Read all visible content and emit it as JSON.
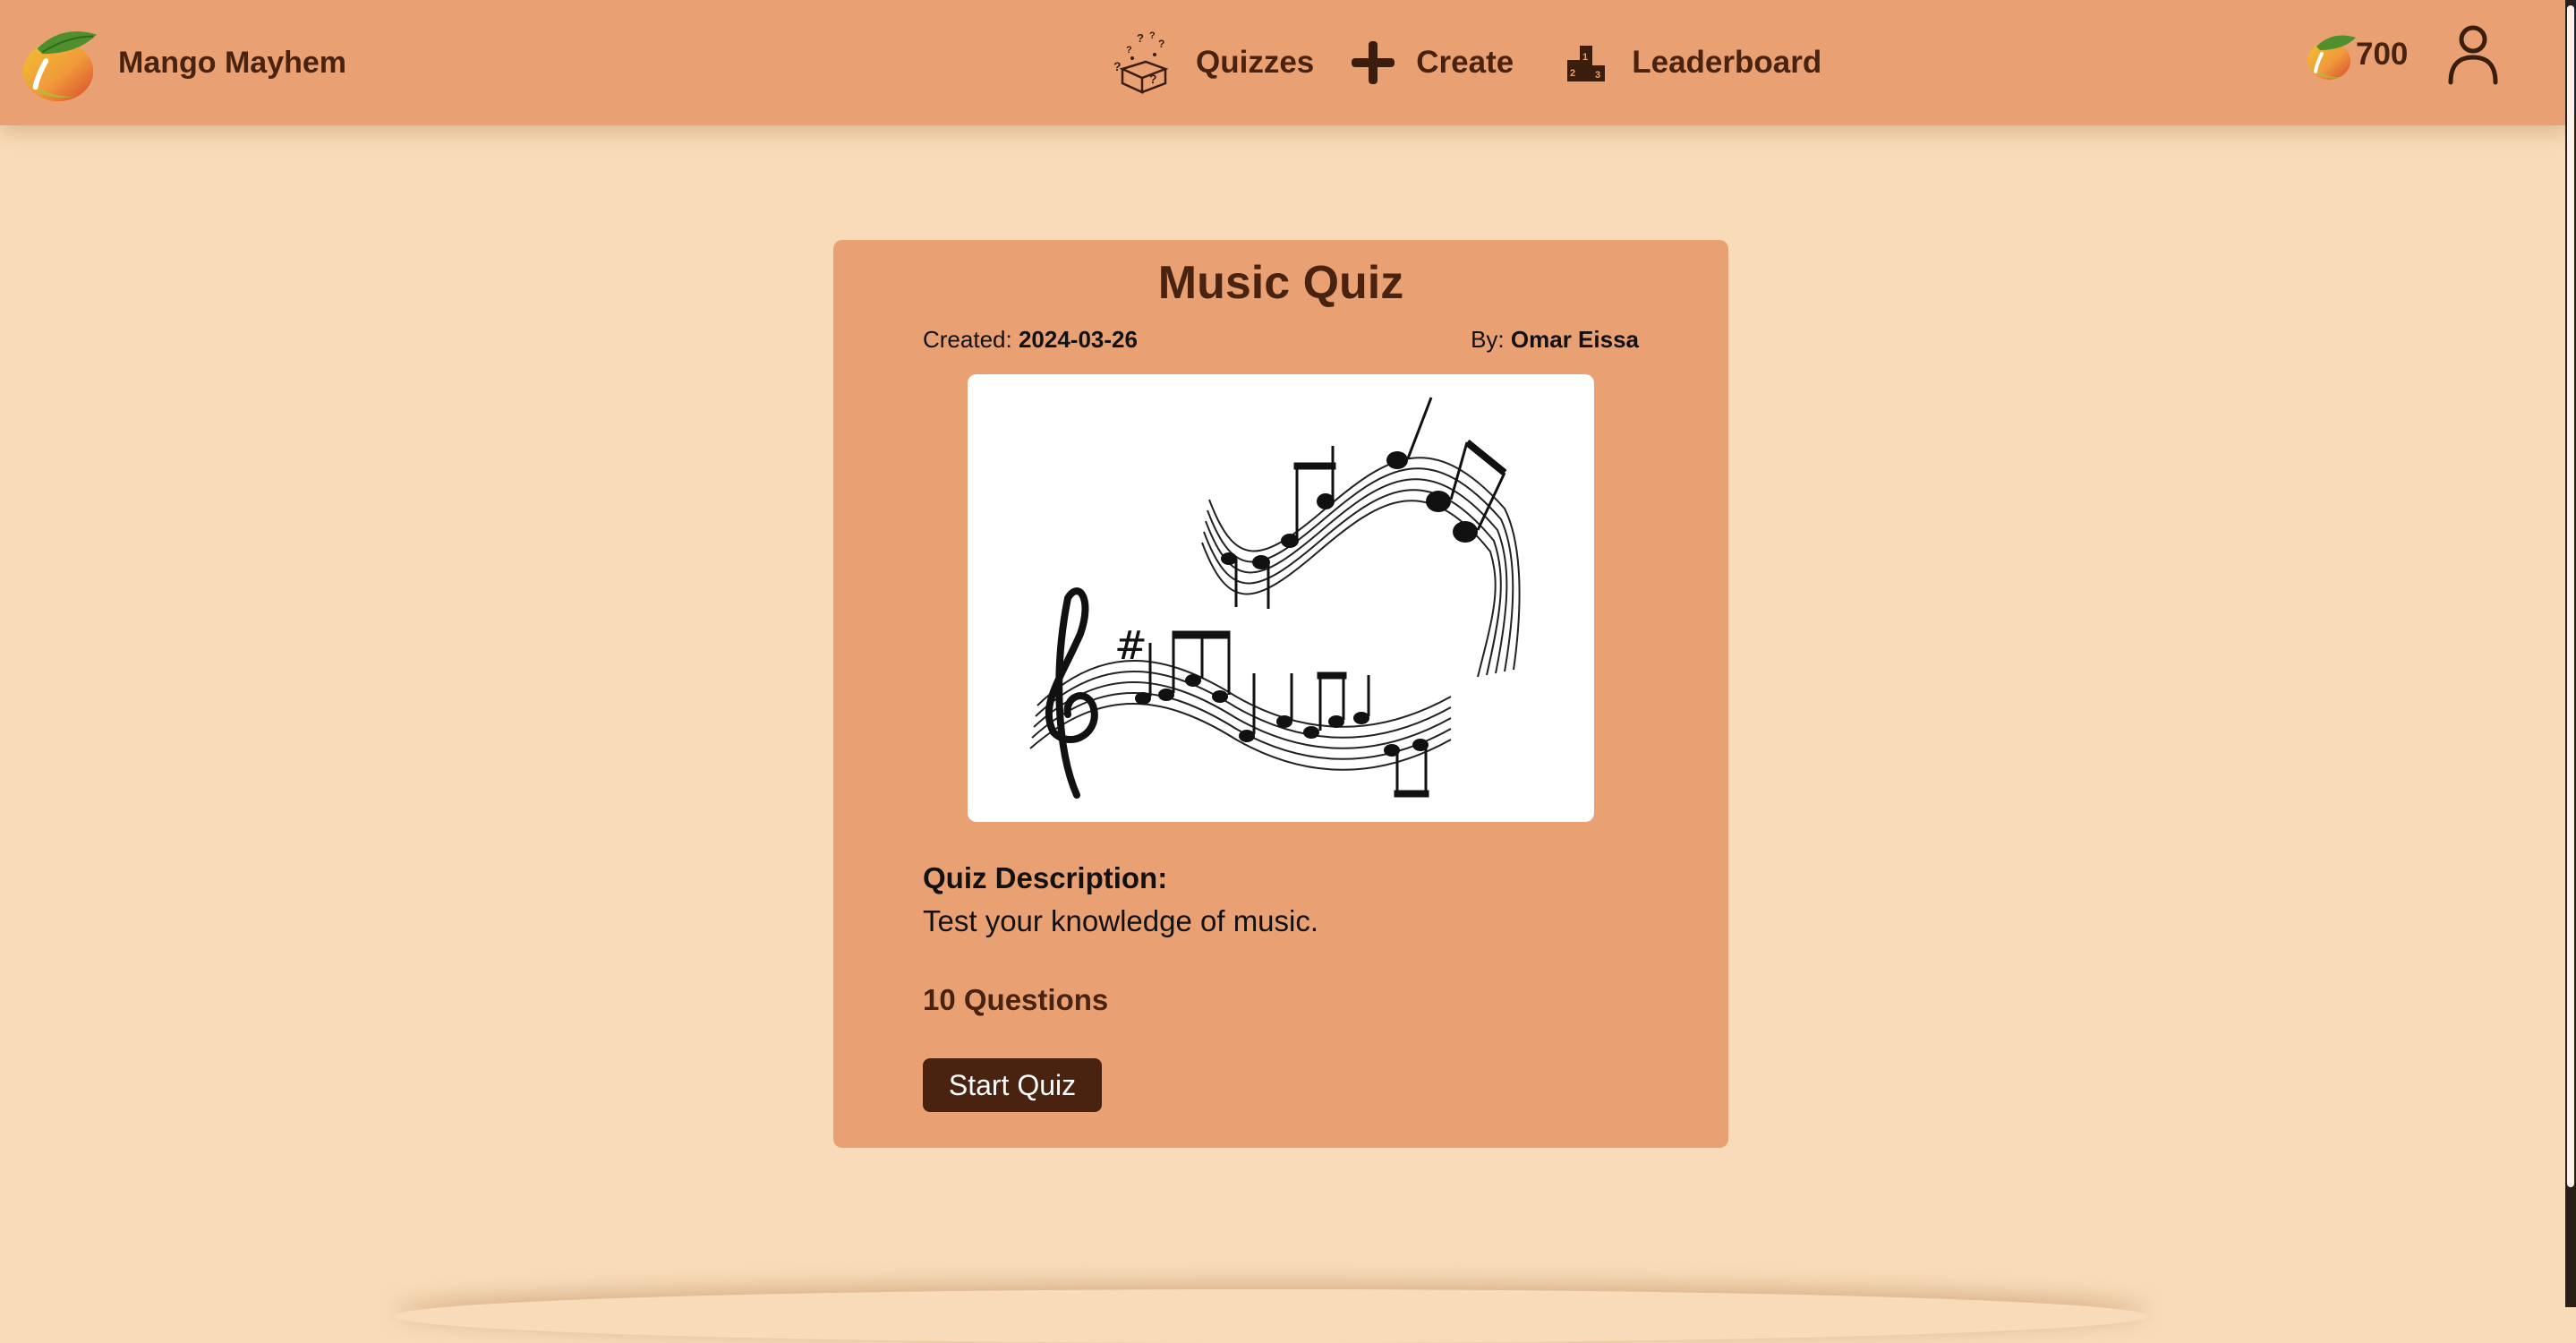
{
  "app": {
    "brand_name": "Mango Mayhem",
    "logo_icon": "mango-logo-icon"
  },
  "nav": {
    "items": [
      {
        "label": "Quizzes",
        "icon": "quizzes-icon"
      },
      {
        "label": "Create",
        "icon": "plus-icon"
      },
      {
        "label": "Leaderboard",
        "icon": "podium-icon"
      }
    ],
    "coins": "700",
    "coin_icon": "mango-coin-icon",
    "profile_icon": "user-icon"
  },
  "quiz": {
    "title": "Music Quiz",
    "created_label": "Created:",
    "created_date": "2024-03-26",
    "author_label": "By:",
    "author": "Omar Eissa",
    "image_icon": "music-notes-image",
    "description_label": "Quiz Description:",
    "description": "Test your knowledge of music.",
    "questions": "10 Questions",
    "start_label": "Start Quiz"
  },
  "colors": {
    "page_bg": "#f8dcb9",
    "header_bg": "#e9a173",
    "card_bg": "#e9a173",
    "accent_dark": "#4a2310"
  }
}
